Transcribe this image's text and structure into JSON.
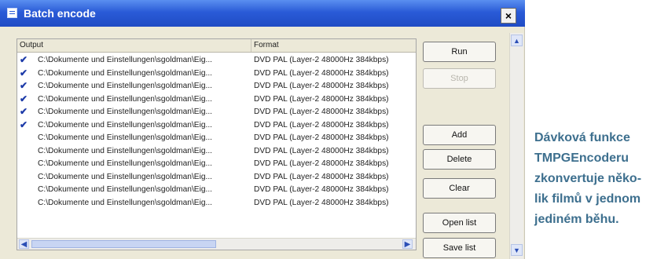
{
  "window": {
    "title": "Batch encode",
    "close_label": "×"
  },
  "list": {
    "headers": {
      "output": "Output",
      "format": "Format"
    },
    "rows": [
      {
        "checked": true,
        "check_glyph": "✔",
        "output": "C:\\Dokumente und Einstellungen\\sgoldman\\Eig...",
        "format": "DVD PAL (Layer-2 48000Hz 384kbps)"
      },
      {
        "checked": true,
        "check_glyph": "✔",
        "output": "C:\\Dokumente und Einstellungen\\sgoldman\\Eig...",
        "format": "DVD PAL (Layer-2 48000Hz 384kbps)"
      },
      {
        "checked": true,
        "check_glyph": "✔",
        "output": "C:\\Dokumente und Einstellungen\\sgoldman\\Eig...",
        "format": "DVD PAL (Layer-2 48000Hz 384kbps)"
      },
      {
        "checked": true,
        "check_glyph": "✔",
        "output": "C:\\Dokumente und Einstellungen\\sgoldman\\Eig...",
        "format": "DVD PAL (Layer-2 48000Hz 384kbps)"
      },
      {
        "checked": true,
        "check_glyph": "✔",
        "output": "C:\\Dokumente und Einstellungen\\sgoldman\\Eig...",
        "format": "DVD PAL (Layer-2 48000Hz 384kbps)"
      },
      {
        "checked": true,
        "check_glyph": "✔",
        "output": "C:\\Dokumente und Einstellungen\\sgoldman\\Eig...",
        "format": "DVD PAL (Layer-2 48000Hz 384kbps)"
      },
      {
        "checked": false,
        "check_glyph": "",
        "output": "C:\\Dokumente und Einstellungen\\sgoldman\\Eig...",
        "format": "DVD PAL (Layer-2 48000Hz 384kbps)"
      },
      {
        "checked": false,
        "check_glyph": "",
        "output": "C:\\Dokumente und Einstellungen\\sgoldman\\Eig...",
        "format": "DVD PAL (Layer-2 48000Hz 384kbps)"
      },
      {
        "checked": false,
        "check_glyph": "",
        "output": "C:\\Dokumente und Einstellungen\\sgoldman\\Eig...",
        "format": "DVD PAL (Layer-2 48000Hz 384kbps)"
      },
      {
        "checked": false,
        "check_glyph": "",
        "output": "C:\\Dokumente und Einstellungen\\sgoldman\\Eig...",
        "format": "DVD PAL (Layer-2 48000Hz 384kbps)"
      },
      {
        "checked": false,
        "check_glyph": "",
        "output": "C:\\Dokumente und Einstellungen\\sgoldman\\Eig...",
        "format": "DVD PAL (Layer-2 48000Hz 384kbps)"
      },
      {
        "checked": false,
        "check_glyph": "",
        "output": "C:\\Dokumente und Einstellungen\\sgoldman\\Eig...",
        "format": "DVD PAL (Layer-2 48000Hz 384kbps)"
      }
    ],
    "scroll_left_glyph": "◀",
    "scroll_right_glyph": "▶"
  },
  "buttons": {
    "run": "Run",
    "stop": "Stop",
    "add": "Add",
    "delete": "Delete",
    "clear": "Clear",
    "open_list": "Open list",
    "save_list": "Save list"
  },
  "vscroll": {
    "up_glyph": "▲",
    "down_glyph": "▼"
  },
  "caption": {
    "lines": [
      "Dávková funkce",
      "TMPGEncoderu",
      "zkonvertuje něko-",
      "lik filmů v jednom",
      "jediném běhu."
    ]
  },
  "colors": {
    "titlebar": "#2a5bd7",
    "window_face": "#ece9d8",
    "check": "#1c3aa8",
    "caption_text": "#3d6f8e"
  },
  "icons": [
    "window-app-icon",
    "close-icon",
    "check-icon",
    "scroll-left-icon",
    "scroll-right-icon",
    "scroll-up-icon",
    "scroll-down-icon"
  ]
}
